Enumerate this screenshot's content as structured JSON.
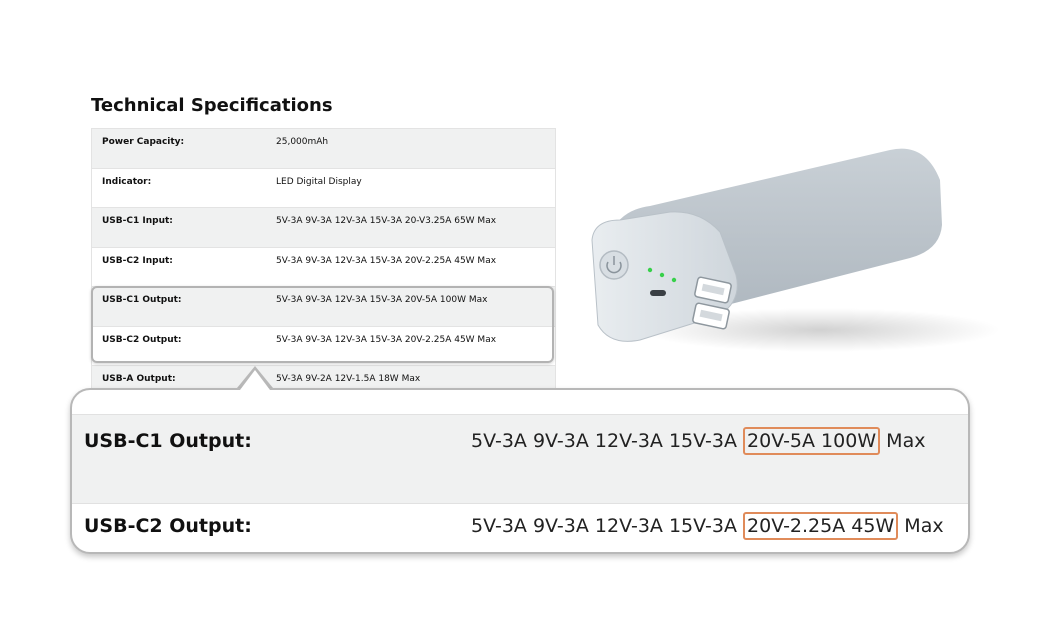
{
  "title": "Technical Specifications",
  "specs": [
    {
      "label": "Power Capacity:",
      "value": "25,000mAh"
    },
    {
      "label": "Indicator:",
      "value": "LED Digital Display"
    },
    {
      "label": "USB-C1 Input:",
      "value": "5V-3A 9V-3A 12V-3A 15V-3A 20-V3.25A 65W Max"
    },
    {
      "label": "USB-C2 Input:",
      "value": "5V-3A 9V-3A 12V-3A 15V-3A 20V-2.25A 45W Max"
    },
    {
      "label": "USB-C1 Output:",
      "value": "5V-3A 9V-3A 12V-3A 15V-3A 20V-5A 100W Max"
    },
    {
      "label": "USB-C2 Output:",
      "value": "5V-3A 9V-3A 12V-3A 15V-3A 20V-2.25A 45W Max"
    },
    {
      "label": "USB-A Output:",
      "value": "5V-3A 9V-2A 12V-1.5A 18W Max"
    }
  ],
  "zoom": {
    "row1": {
      "label": "USB-C1 Output:",
      "prefix": "5V-3A 9V-3A 12V-3A 15V-3A",
      "highlight": "20V-5A 100W",
      "suffix": "Max"
    },
    "row2": {
      "label": "USB-C2 Output:",
      "prefix": "5V-3A 9V-3A 12V-3A 15V-3A",
      "highlight": "20V-2.25A 45W",
      "suffix": "Max"
    }
  },
  "colors": {
    "highlight_border": "#e08b5a",
    "row_shade": "#f0f1f1",
    "led": "#37d04a"
  },
  "image": {
    "name": "power-bank-product-image"
  }
}
